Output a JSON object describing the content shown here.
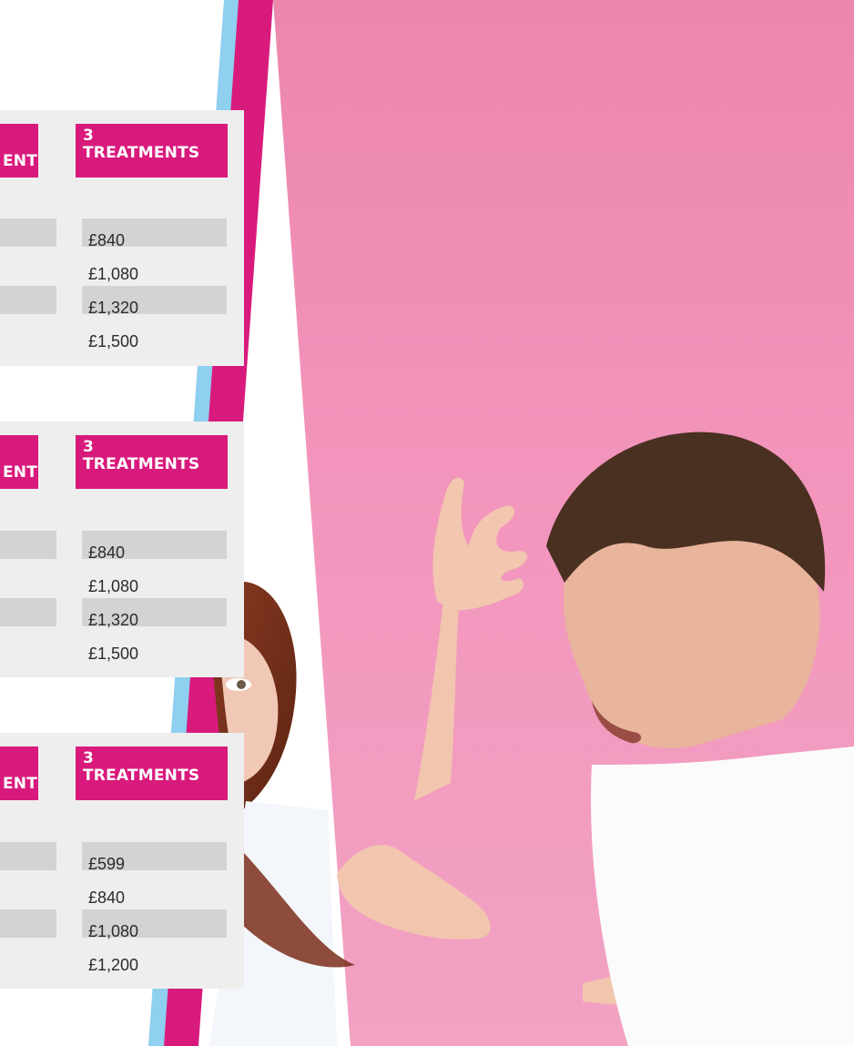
{
  "panels": [
    {
      "left_header": "ENT",
      "right_header": [
        "3",
        "TREATMENTS"
      ],
      "prices": [
        "£840",
        "£1,080",
        "£1,320",
        "£1,500"
      ]
    },
    {
      "left_header": "ENT",
      "right_header": [
        "3",
        "TREATMENTS"
      ],
      "prices": [
        "£840",
        "£1,080",
        "£1,320",
        "£1,500"
      ]
    },
    {
      "left_header": "ENT",
      "right_header": [
        "3",
        "TREATMENTS"
      ],
      "prices": [
        "£599",
        "£840",
        "£1,080",
        "£1,200"
      ]
    }
  ],
  "colors": {
    "accent": "#d91a7d",
    "stripe_blue": "#8fcfef",
    "pink_background": "#f090b8",
    "panel_background": "#eeeeee",
    "row_shade": "#d3d3d3"
  }
}
